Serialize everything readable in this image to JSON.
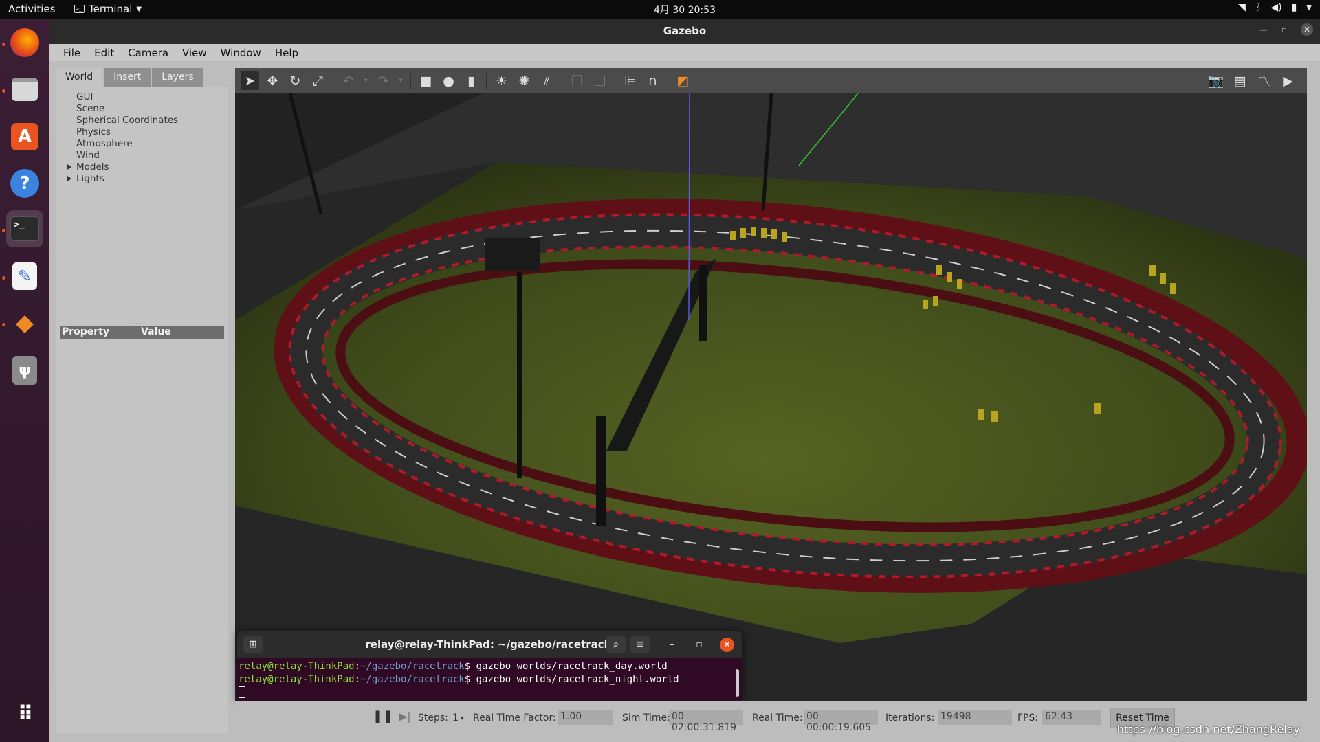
{
  "topbar": {
    "activities": "Activities",
    "app_name": "Terminal",
    "clock": "4月 30  20:53"
  },
  "window": {
    "title": "Gazebo"
  },
  "menu": [
    "File",
    "Edit",
    "Camera",
    "View",
    "Window",
    "Help"
  ],
  "left_panel": {
    "tabs": [
      "World",
      "Insert",
      "Layers"
    ],
    "tree": [
      "GUI",
      "Scene",
      "Spherical Coordinates",
      "Physics",
      "Atmosphere",
      "Wind",
      "Models",
      "Lights"
    ],
    "property_header": "Property",
    "value_header": "Value"
  },
  "statusbar": {
    "steps_label": "Steps:",
    "steps_value": "1",
    "rtf_label": "Real Time Factor:",
    "rtf_value": "1.00",
    "sim_label": "Sim Time:",
    "sim_value": "00 02:00:31.819",
    "real_label": "Real Time:",
    "real_value": "00 00:00:19.605",
    "iter_label": "Iterations:",
    "iter_value": "19498",
    "fps_label": "FPS:",
    "fps_value": "62.43",
    "reset_label": "Reset Time"
  },
  "watermark": "https://blog.csdn.net/ZhangRelay",
  "terminal": {
    "title": "relay@relay-ThinkPad: ~/gazebo/racetrack",
    "user": "relay@relay-ThinkPad",
    "path": "~/gazebo/racetrack",
    "cmd1": "$ gazebo worlds/racetrack_day.world",
    "cmd2": "$ gazebo worlds/racetrack_night.world"
  },
  "colors": {
    "accent": "#e95420",
    "prompt_user": "#8ae234",
    "prompt_path": "#729fcf",
    "terminal_bg": "#300a24"
  }
}
